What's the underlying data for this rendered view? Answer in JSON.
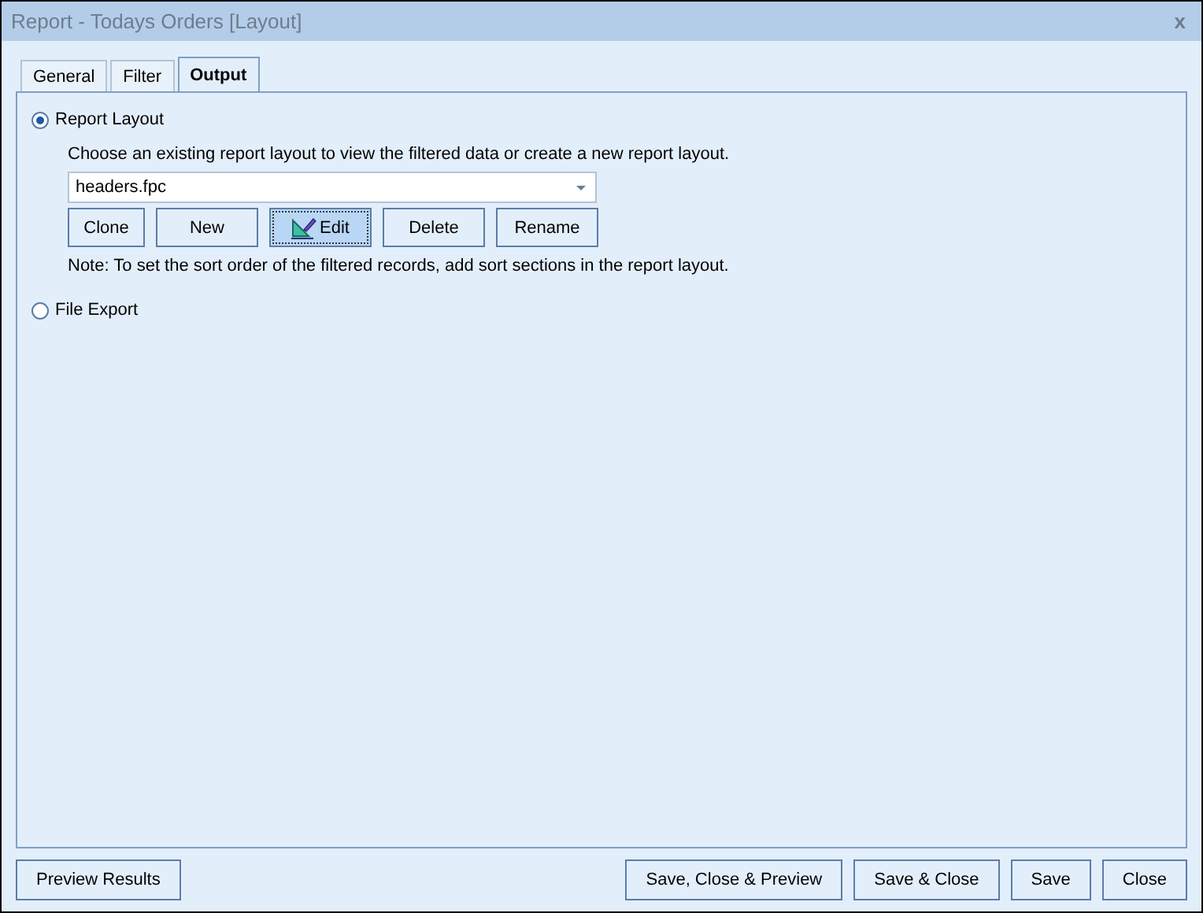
{
  "window": {
    "title": "Report - Todays Orders [Layout]",
    "close": "x"
  },
  "tabs": [
    {
      "label": "General",
      "selected": false
    },
    {
      "label": "Filter",
      "selected": false
    },
    {
      "label": "Output",
      "selected": true
    }
  ],
  "options": [
    {
      "label": "Report Layout",
      "selected": true,
      "description": "Choose an existing report layout to view the filtered data or create a new report layout.",
      "layout_file": "headers.fpc",
      "buttons": [
        {
          "label": "Clone",
          "focused": false,
          "icon": false
        },
        {
          "label": "New",
          "focused": false,
          "icon": false
        },
        {
          "label": "Edit",
          "focused": true,
          "icon": true
        },
        {
          "label": "Delete",
          "focused": false,
          "icon": false
        },
        {
          "label": "Rename",
          "focused": false,
          "icon": false
        }
      ],
      "note": "Note: To set the sort order of the filtered records, add sort sections in the report layout."
    },
    {
      "label": "File Export",
      "selected": false
    }
  ],
  "footer": {
    "left": [
      "Preview Results"
    ],
    "right": [
      "Save, Close & Preview",
      "Save & Close",
      "Save",
      "Close"
    ]
  }
}
